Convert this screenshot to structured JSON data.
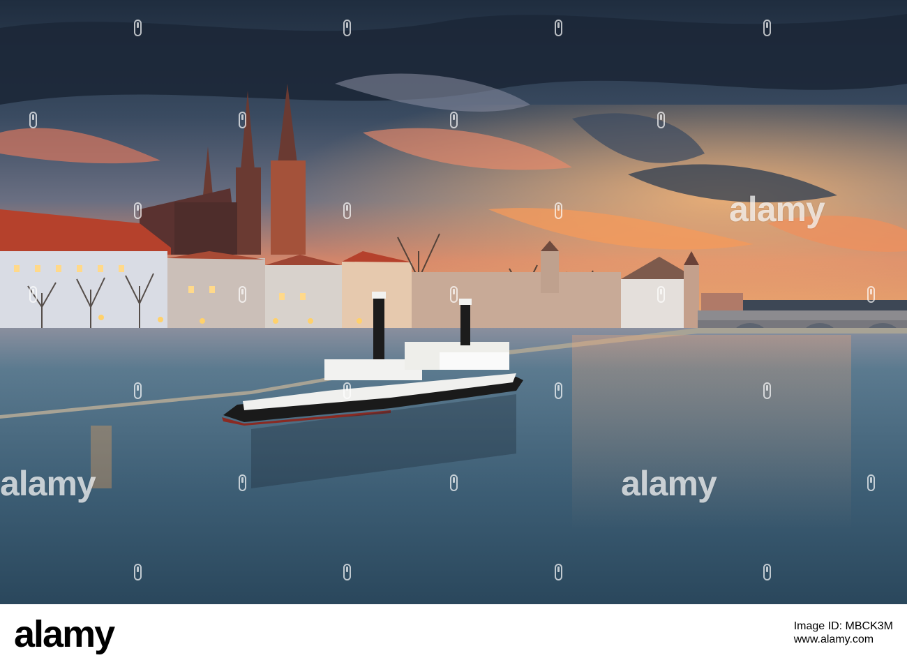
{
  "watermark": {
    "brand": "alamy"
  },
  "footer": {
    "logo": "alamy",
    "image_id": "Image ID: MBCK3M",
    "site": "www.alamy.com"
  },
  "colors": {
    "sky_top": "#2b3a4d",
    "sky_glow": "#f08a5c",
    "river": "#4c6f86",
    "roof": "#b5412c"
  }
}
